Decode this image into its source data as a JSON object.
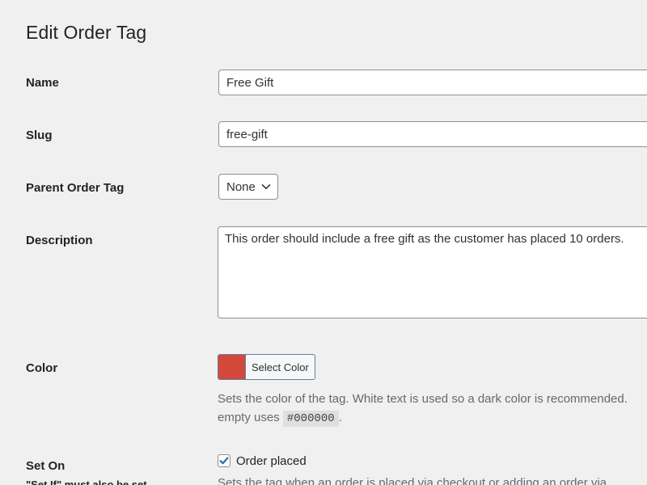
{
  "page": {
    "title": "Edit Order Tag"
  },
  "fields": {
    "name": {
      "label": "Name",
      "value": "Free Gift"
    },
    "slug": {
      "label": "Slug",
      "value": "free-gift"
    },
    "parent": {
      "label": "Parent Order Tag",
      "selected": "None"
    },
    "description": {
      "label": "Description",
      "value": "This order should include a free gift as the customer has placed 10 orders."
    },
    "color": {
      "label": "Color",
      "button_label": "Select Color",
      "swatch": "#d44839",
      "help_line1": "Sets the color of the tag. White text is used so a dark color is recommended.",
      "help_line2_prefix": "empty uses",
      "help_code": "#000000",
      "help_line2_suffix": "."
    },
    "set_on": {
      "label": "Set On",
      "sub_label": "\"Set If\" must also be set",
      "checkbox_label": "Order placed",
      "checked": true,
      "help": "Sets the tag when an order is placed via checkout or adding an order via"
    }
  },
  "icons": {
    "select_arrow": "chevron-down-icon",
    "checkbox_mark": "check-icon"
  },
  "colors": {
    "background": "#f0f0f1",
    "accent": "#2271b1"
  }
}
